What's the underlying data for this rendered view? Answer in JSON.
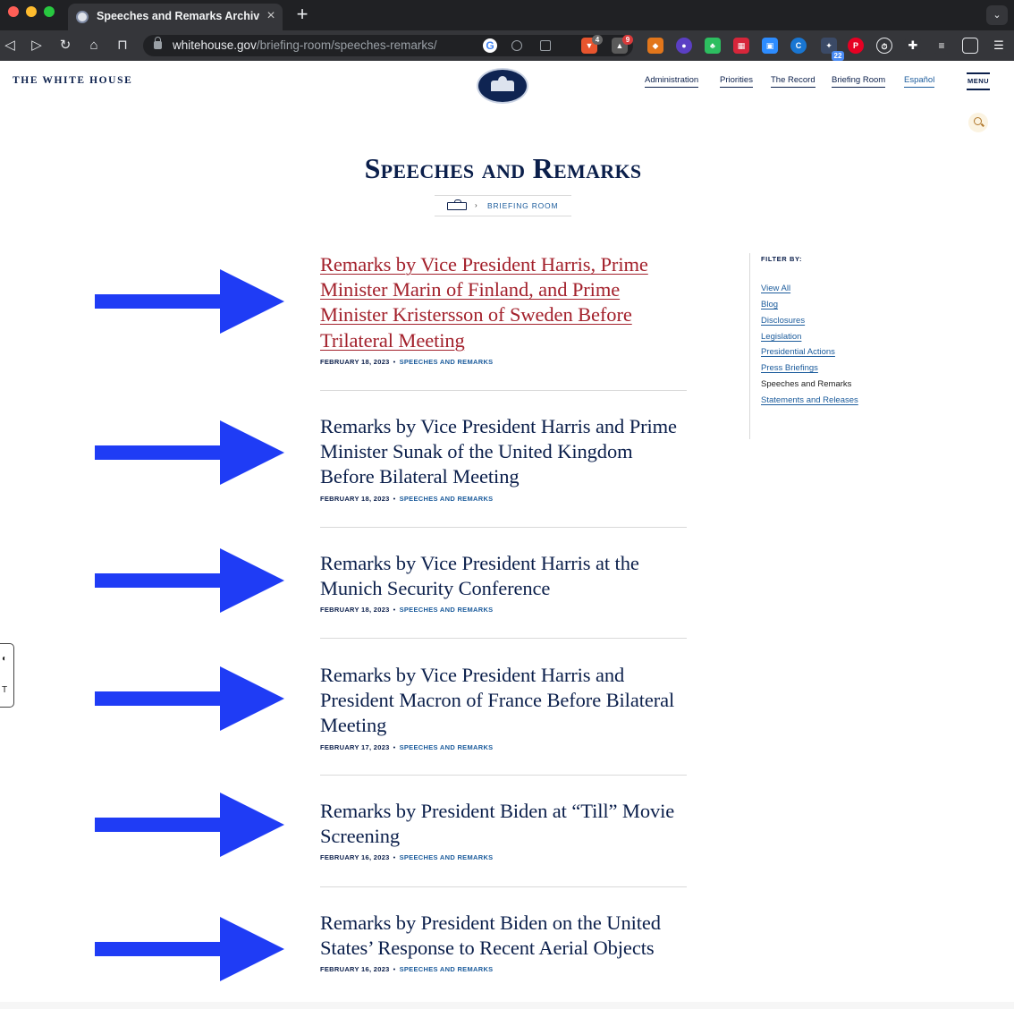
{
  "browser": {
    "tab_title": "Speeches and Remarks Archive",
    "url_host": "whitehouse.gov",
    "url_path": "/briefing-room/speeches-remarks/",
    "extension_badges": {
      "brave": "4",
      "rewards": "9",
      "counter": "22"
    }
  },
  "header": {
    "logo_text": "THE WHITE HOUSE",
    "nav": [
      "Administration",
      "Priorities",
      "The Record",
      "Briefing Room",
      "Español"
    ],
    "menu_label": "MENU"
  },
  "page": {
    "title": "Speeches and Remarks",
    "breadcrumb": "BRIEFING ROOM"
  },
  "articles": [
    {
      "title": "Remarks by Vice President Harris, Prime Minister Marin of Finland, and Prime Minister Kristersson of Sweden Before Trilateral Meeting",
      "date": "FEBRUARY 18, 2023",
      "category": "SPEECHES AND REMARKS"
    },
    {
      "title": "Remarks by Vice President Harris and Prime Minister Sunak of the United Kingdom Before Bilateral Meeting",
      "date": "FEBRUARY 18, 2023",
      "category": "SPEECHES AND REMARKS"
    },
    {
      "title": "Remarks by Vice President Harris at the Munich Security Conference",
      "date": "FEBRUARY 18, 2023",
      "category": "SPEECHES AND REMARKS"
    },
    {
      "title": "Remarks by Vice President Harris and President Macron of France Before Bilateral Meeting",
      "date": "FEBRUARY 17, 2023",
      "category": "SPEECHES AND REMARKS"
    },
    {
      "title": "Remarks by President Biden at “Till” Movie Screening",
      "date": "FEBRUARY 16, 2023",
      "category": "SPEECHES AND REMARKS"
    },
    {
      "title": "Remarks by President Biden on the United States’ Response to Recent Aerial Objects",
      "date": "FEBRUARY 16, 2023",
      "category": "SPEECHES AND REMARKS"
    }
  ],
  "sidebar": {
    "heading": "FILTER BY:",
    "links": [
      "View All",
      "Blog",
      "Disclosures",
      "Legislation",
      "Presidential Actions",
      "Press Briefings",
      "Speeches and Remarks",
      "Statements and Releases"
    ]
  },
  "colors": {
    "navy": "#0b1f4b",
    "link_blue": "#1c5c9c",
    "active_red": "#a3212c",
    "arrow_blue": "#1f3cf5"
  }
}
